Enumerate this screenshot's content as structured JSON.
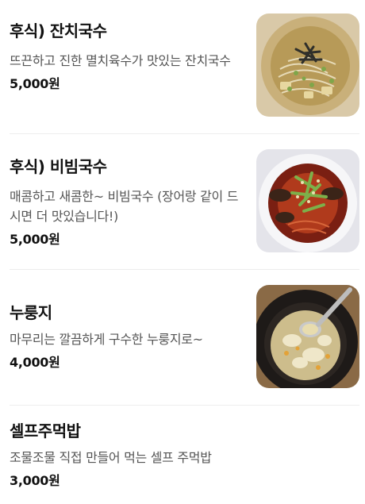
{
  "menu": {
    "items": [
      {
        "name": "후식) 잔치국수",
        "description": "뜨끈하고 진한 멸치육수가 맛있는 잔치국수",
        "price": "5,000원",
        "image_icon": "janchi-guksu-photo"
      },
      {
        "name": "후식) 비빔국수",
        "description": "매콤하고 새콤한~ 비빔국수 (장어랑 같이 드시면 더 맛있습니다!)",
        "price": "5,000원",
        "image_icon": "bibim-guksu-photo"
      },
      {
        "name": "누룽지",
        "description": "마무리는 깔끔하게 구수한 누룽지로~",
        "price": "4,000원",
        "image_icon": "nurungji-photo"
      },
      {
        "name": "셀프주먹밥",
        "description": "조물조물 직접 만들어 먹는 셀프 주먹밥",
        "price": "3,000원"
      }
    ]
  },
  "colors": {
    "text_primary": "#111111",
    "text_secondary": "#555555",
    "divider": "#ededed"
  }
}
